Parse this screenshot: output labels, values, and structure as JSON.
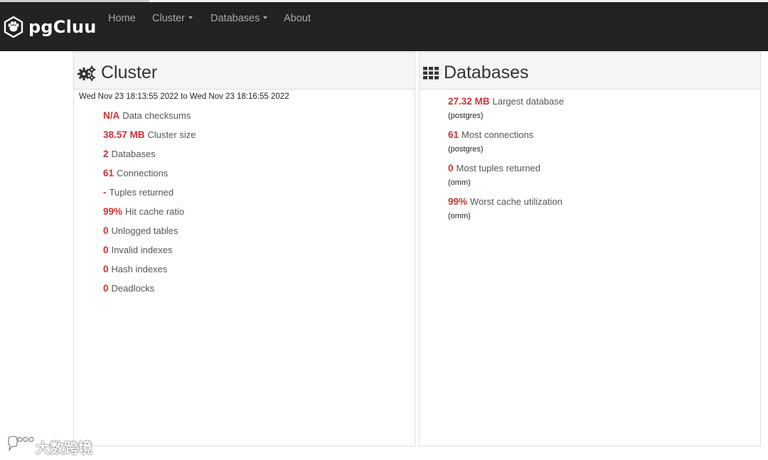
{
  "navbar": {
    "brand": "pgCluu",
    "items": [
      {
        "label": "Home"
      },
      {
        "label": "Cluster"
      },
      {
        "label": "Databases"
      },
      {
        "label": "About"
      }
    ]
  },
  "cluster": {
    "title": "Cluster",
    "date_range": "Wed Nov 23 18:13:55 2022 to Wed Nov 23 18:16:55 2022",
    "stats": [
      {
        "value": "N/A",
        "label": "Data checksums"
      },
      {
        "value": "38.57 MB",
        "label": "Cluster size"
      },
      {
        "value": "2",
        "label": "Databases"
      },
      {
        "value": "61",
        "label": "Connections"
      },
      {
        "value": "-",
        "label": "Tuples returned"
      },
      {
        "value": "99%",
        "label": "Hit cache ratio"
      },
      {
        "value": "0",
        "label": "Unlogged tables"
      },
      {
        "value": "0",
        "label": "Invalid indexes"
      },
      {
        "value": "0",
        "label": "Hash indexes"
      },
      {
        "value": "0",
        "label": "Deadlocks"
      }
    ]
  },
  "databases": {
    "title": "Databases",
    "stats": [
      {
        "value": "27.32 MB",
        "label": "Largest database",
        "db": "(postgres)"
      },
      {
        "value": "61",
        "label": "Most connections",
        "db": "(postgres)"
      },
      {
        "value": "0",
        "label": "Most tuples returned",
        "db": "(omm)"
      },
      {
        "value": "99%",
        "label": "Worst cache utilization",
        "db": "(omm)"
      }
    ]
  },
  "watermark": {
    "text": "大数跨境"
  },
  "colors": {
    "navbar_bg": "#222222",
    "value_red": "#cc3333",
    "panel_head_bg": "#f5f5f5"
  },
  "icons": {
    "brand": "elephant-hexagon-icon",
    "cluster": "gears-icon",
    "databases": "grid-icon",
    "watermark": "chat-bubble-icon"
  }
}
